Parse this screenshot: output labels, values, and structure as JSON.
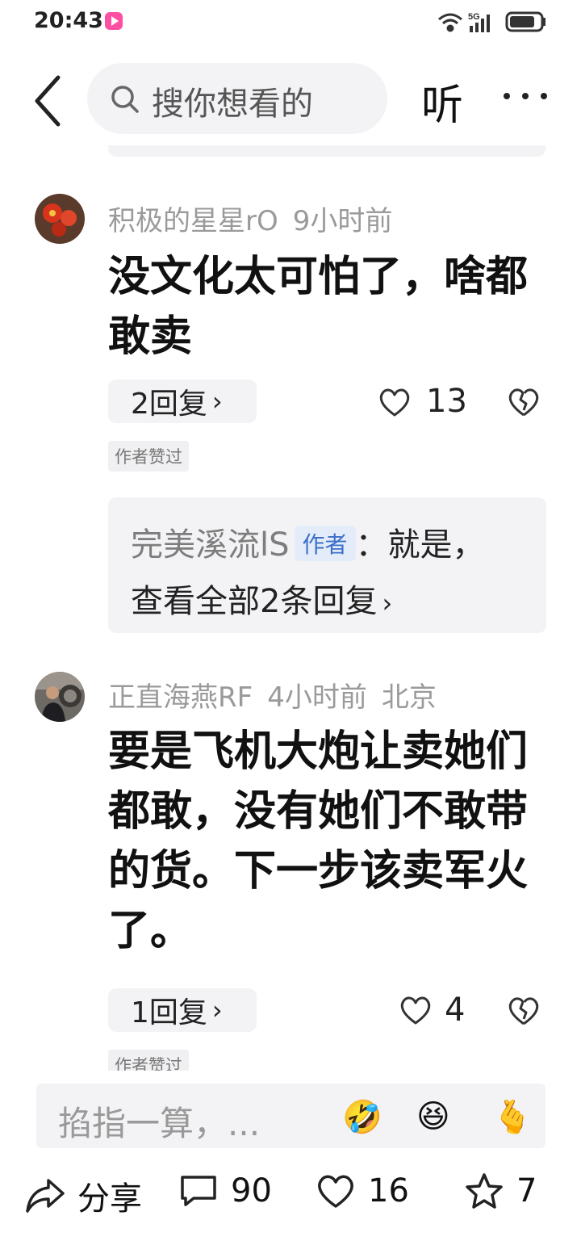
{
  "status_bar": {
    "time": "20:43",
    "network": "5G"
  },
  "header": {
    "search_placeholder": "搜你想看的",
    "listen_label": "听"
  },
  "comments": [
    {
      "username": "积极的星星rO",
      "time": "9小时前",
      "location": "",
      "text": "没文化太可怕了，啥都敢卖",
      "reply_label": "2回复",
      "likes": "13",
      "author_liked_tag": "作者赞过",
      "reply_preview": {
        "name": "完美溪流lS",
        "author_tag": "作者",
        "text": "：就是，",
        "view_all": "查看全部2条回复"
      }
    },
    {
      "username": "正直海燕RF",
      "time": "4小时前",
      "location": "北京",
      "text": "要是飞机大炮让卖她们都敢，没有她们不敢带的货。下一步该卖军火了。",
      "reply_label": "1回复",
      "likes": "4",
      "author_liked_tag": "作者赞过"
    }
  ],
  "bottom_bar": {
    "input_placeholder": "掐指一算，...",
    "emojis": [
      "🤣",
      "😆",
      "🫰"
    ],
    "share_label": "分享",
    "comment_count": "90",
    "like_count": "16",
    "favorite_count": "7"
  }
}
